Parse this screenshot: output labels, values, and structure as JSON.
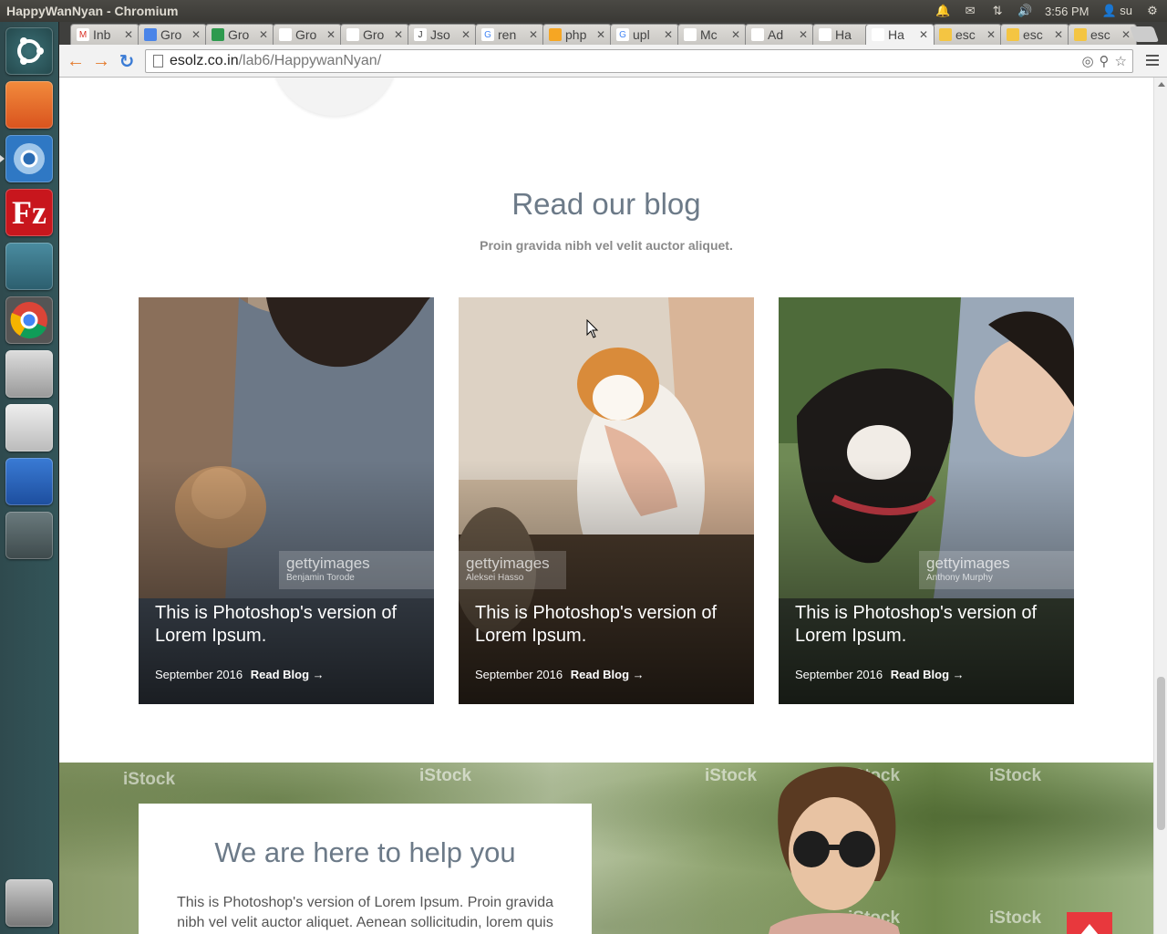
{
  "window": {
    "title": "HappyWanNyan - Chromium",
    "clock": "3:56 PM",
    "user": "su"
  },
  "launcher": {
    "items": [
      "Ubuntu Dash",
      "Files",
      "Chromium",
      "FileZilla",
      "MySQL Workbench",
      "Google Chrome",
      "Database",
      "Text Editor",
      "LibreOffice Writer",
      "Workspace Switcher",
      "Trash"
    ]
  },
  "tabs": [
    {
      "label": "Inb",
      "icon": "gmail-icon"
    },
    {
      "label": "Gro",
      "icon": "docs-icon"
    },
    {
      "label": "Gro",
      "icon": "sheets-icon"
    },
    {
      "label": "Gro",
      "icon": "page-icon"
    },
    {
      "label": "Gro",
      "icon": "page-icon"
    },
    {
      "label": "Jso",
      "icon": "json-icon"
    },
    {
      "label": "ren",
      "icon": "google-icon"
    },
    {
      "label": "php",
      "icon": "php-icon"
    },
    {
      "label": "upl",
      "icon": "google-icon"
    },
    {
      "label": "Mc",
      "icon": "globe-icon"
    },
    {
      "label": "Ad",
      "icon": "page-icon"
    },
    {
      "label": "Ha",
      "icon": "page-icon"
    },
    {
      "label": "Ha",
      "icon": "happywannyan-icon"
    },
    {
      "label": "esc",
      "icon": "phpmyadmin-icon"
    },
    {
      "label": "esc",
      "icon": "phpmyadmin-icon"
    },
    {
      "label": "esc",
      "icon": "phpmyadmin-icon"
    }
  ],
  "address": {
    "host": "esolz.co.in",
    "path": "/lab6/HappywanNyan/"
  },
  "blog": {
    "title": "Read our blog",
    "subtitle": "Proin gravida nibh vel velit auctor aliquet.",
    "cards": [
      {
        "title": "This is Photoshop's version of Lorem Ipsum.",
        "date": "September 2016",
        "link": "Read Blog →",
        "watermark": "gettyimages",
        "credit": "Benjamin Torode"
      },
      {
        "title": "This is Photoshop's version of Lorem Ipsum.",
        "date": "September 2016",
        "link": "Read Blog →",
        "watermark": "gettyimages",
        "credit": "Aleksei Hasso"
      },
      {
        "title": "This is Photoshop's version of Lorem Ipsum.",
        "date": "September 2016",
        "link": "Read Blog →",
        "watermark": "gettyimages",
        "credit": "Anthony Murphy"
      }
    ]
  },
  "help": {
    "title": "We are here to help you",
    "text": "This is Photoshop's version of Lorem Ipsum. Proin gravida nibh vel velit auctor aliquet. Aenean sollicitudin, lorem quis bibendum auctor, nisi elit consequat ipsum, nec",
    "watermark": "iStock"
  },
  "colors": {
    "heading": "#6c7a88",
    "back_to_top": "#e8383d",
    "launcher": "#335559"
  }
}
